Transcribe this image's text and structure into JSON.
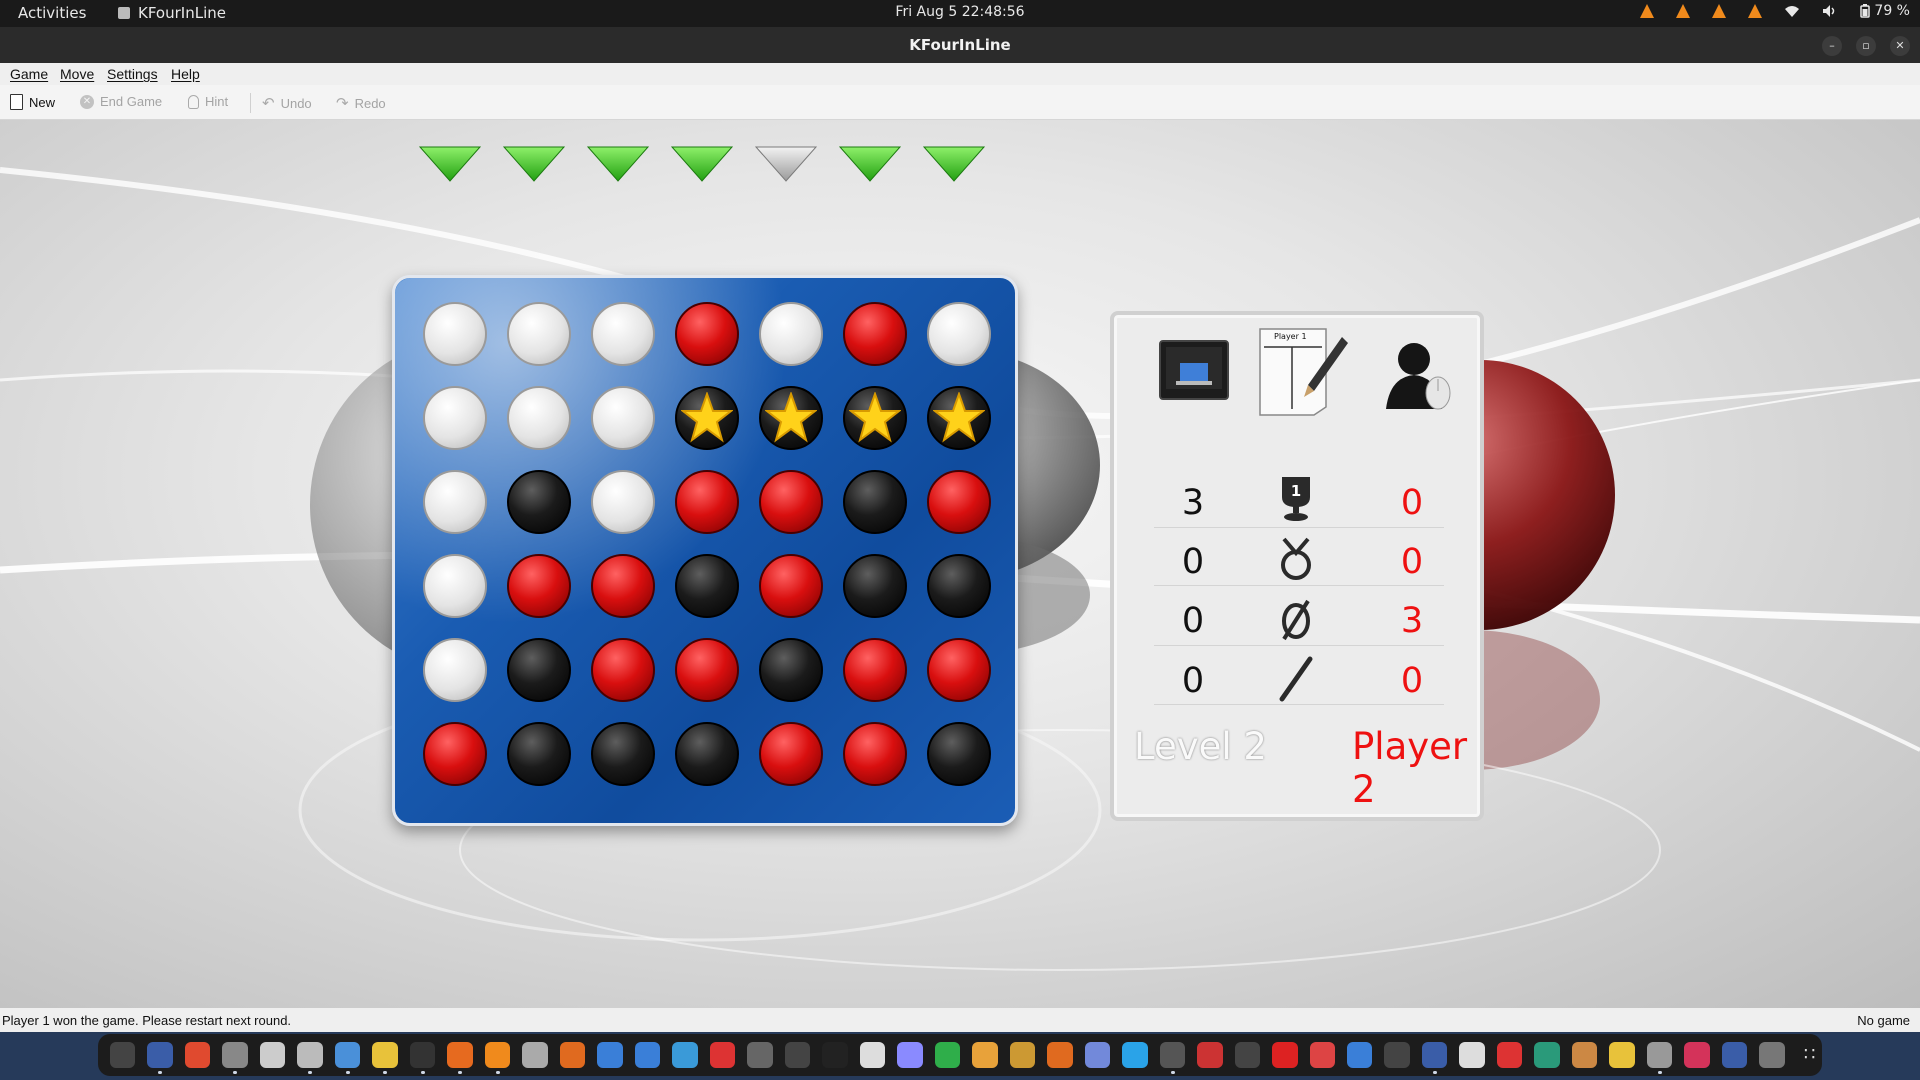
{
  "system_bar": {
    "activities": "Activities",
    "app_name": "KFourInLine",
    "datetime": "Fri Aug 5  22:48:56",
    "battery": "79 %"
  },
  "window": {
    "title": "KFourInLine"
  },
  "menu": {
    "game": "Game",
    "move": "Move",
    "settings": "Settings",
    "help": "Help"
  },
  "toolbar": {
    "new": "New",
    "end_game": "End Game",
    "hint": "Hint",
    "undo": "Undo",
    "redo": "Redo"
  },
  "column_arrows": [
    "green",
    "green",
    "green",
    "green",
    "gray",
    "green",
    "green"
  ],
  "board": {
    "rows": [
      [
        "empty",
        "empty",
        "empty",
        "red",
        "empty",
        "red",
        "empty"
      ],
      [
        "empty",
        "empty",
        "empty",
        "star",
        "star",
        "star",
        "star"
      ],
      [
        "empty",
        "black",
        "empty",
        "red",
        "red",
        "black",
        "red"
      ],
      [
        "empty",
        "red",
        "red",
        "black",
        "red",
        "black",
        "black"
      ],
      [
        "empty",
        "black",
        "red",
        "red",
        "black",
        "red",
        "red"
      ],
      [
        "red",
        "black",
        "black",
        "black",
        "red",
        "red",
        "black"
      ]
    ]
  },
  "scoreboard": {
    "header_icons": [
      "computer-icon",
      "player-turn-paper-icon",
      "user-mouse-icon"
    ],
    "turn_label": "Player 1",
    "rows": [
      {
        "icon": "trophy-icon",
        "p1": "3",
        "p2": "0"
      },
      {
        "icon": "loss-icon",
        "p1": "0",
        "p2": "0"
      },
      {
        "icon": "abort-icon",
        "p1": "0",
        "p2": "3"
      },
      {
        "icon": "draw-icon",
        "p1": "0",
        "p2": "0"
      }
    ],
    "player1_name": "Level 2",
    "player2_name": "Player 2",
    "player1_color": "#111111",
    "player2_color": "#ee1111"
  },
  "status": {
    "message": "Player 1 won the game. Please restart next round.",
    "state": "No game"
  },
  "colors": {
    "board_blue": "#1a5cb2",
    "arrow_green": "#3cc21c",
    "accent_red": "#e01010"
  }
}
